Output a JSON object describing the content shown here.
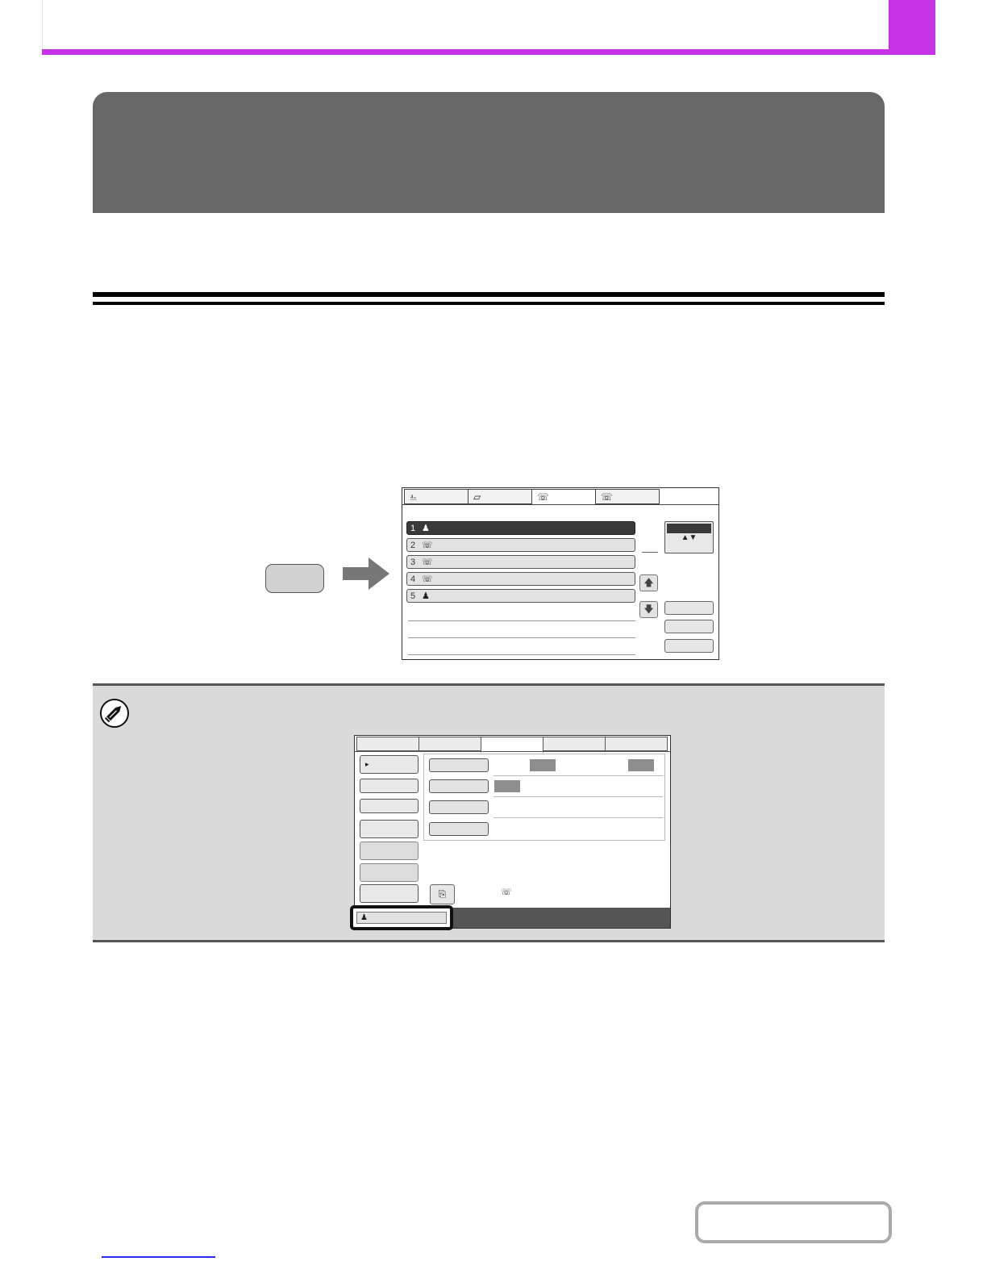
{
  "header": {
    "accent_color": "#c632e6"
  },
  "title_block": {
    "color": "#676767"
  },
  "hardware_key": {
    "label": ""
  },
  "address_book_screen": {
    "tabs": [
      {
        "icon": "copy-tab-icon",
        "glyph": "⎁",
        "active": false
      },
      {
        "icon": "scan-tab-icon",
        "glyph": "▱",
        "active": false
      },
      {
        "icon": "fax-tab-icon",
        "glyph": "☏",
        "active": true
      },
      {
        "icon": "internet-fax-tab-icon",
        "glyph": "☏",
        "active": false
      }
    ],
    "entries": [
      {
        "number": "1",
        "icon": "group-icon",
        "glyph": "♟",
        "selected": true
      },
      {
        "number": "2",
        "icon": "phone-icon",
        "glyph": "☏",
        "selected": false
      },
      {
        "number": "3",
        "icon": "phone-icon",
        "glyph": "☏",
        "selected": false
      },
      {
        "number": "4",
        "icon": "phone-icon",
        "glyph": "☏",
        "selected": false
      },
      {
        "number": "5",
        "icon": "group-icon",
        "glyph": "♟",
        "selected": false
      }
    ],
    "sort_glyph": "▲▼",
    "scroll_up_glyph": "🡅",
    "scroll_down_glyph": "🡇"
  },
  "note": {
    "icon": "pencil-icon",
    "screen": {
      "caret_glyph": "▸",
      "dock_glyph": "⎘",
      "phone_glyph": "☏",
      "highlight_glyph": "♟"
    }
  },
  "footer": {
    "contents_label": ""
  }
}
